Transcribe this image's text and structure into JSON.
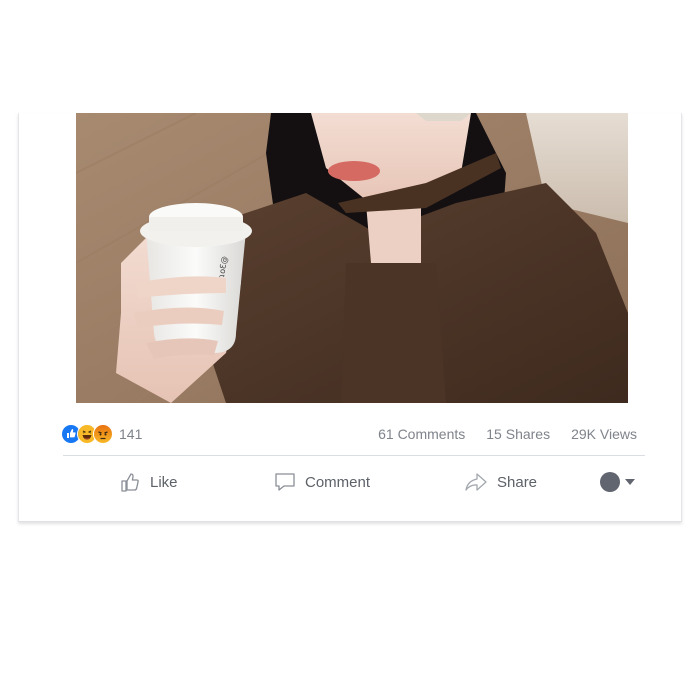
{
  "post": {
    "reaction_count": "141",
    "comments": "61 Comments",
    "shares": "15 Shares",
    "views": "29K Views"
  },
  "actions": {
    "like": "Like",
    "comment": "Comment",
    "share": "Share"
  },
  "reactions": [
    "like-icon",
    "haha-icon",
    "angry-icon"
  ],
  "colors": {
    "like_blue": "#1877f2",
    "reaction_yellow": "#f7b928",
    "angry_orange": "#e9710f",
    "muted_text": "#90949c",
    "action_text": "#5d6168"
  }
}
